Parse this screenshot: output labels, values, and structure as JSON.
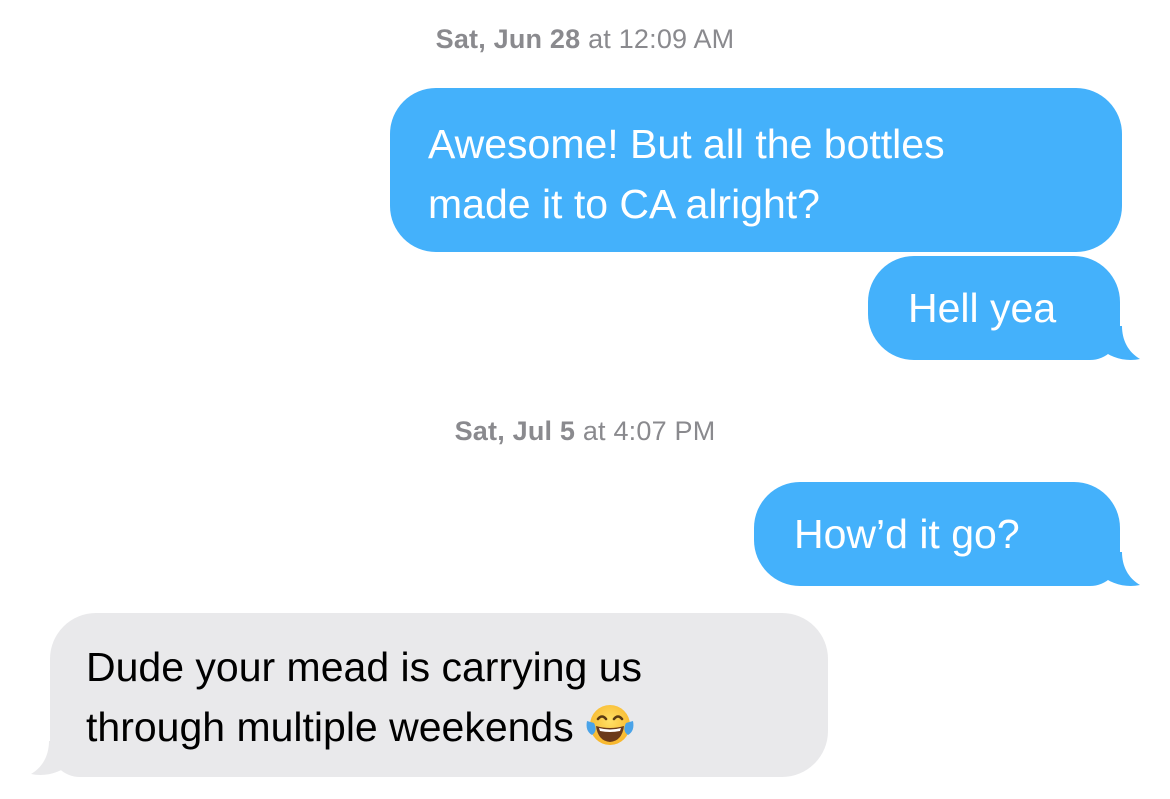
{
  "conversation": {
    "timestamp_1": {
      "day": "Sat, Jun 28",
      "time": "at 12:09 AM"
    },
    "msg_1": "Awesome! But all the bottles made it to CA alright?",
    "msg_1_line1": "Awesome! But all the bottles",
    "msg_1_line2": "made it to CA alright?",
    "msg_2": "Hell yea",
    "timestamp_2": {
      "day": "Sat, Jul 5",
      "time": "at 4:07 PM"
    },
    "msg_3": "How’d it go?",
    "msg_4_line1": "Dude your mead is carrying us",
    "msg_4_line2": "through multiple weekends",
    "msg_4_emoji": "face-with-tears-of-joy-icon"
  },
  "colors": {
    "sent_bubble": "#44b1fb",
    "received_bubble": "#e9e9eb",
    "timestamp_text": "#8a8a8e"
  }
}
